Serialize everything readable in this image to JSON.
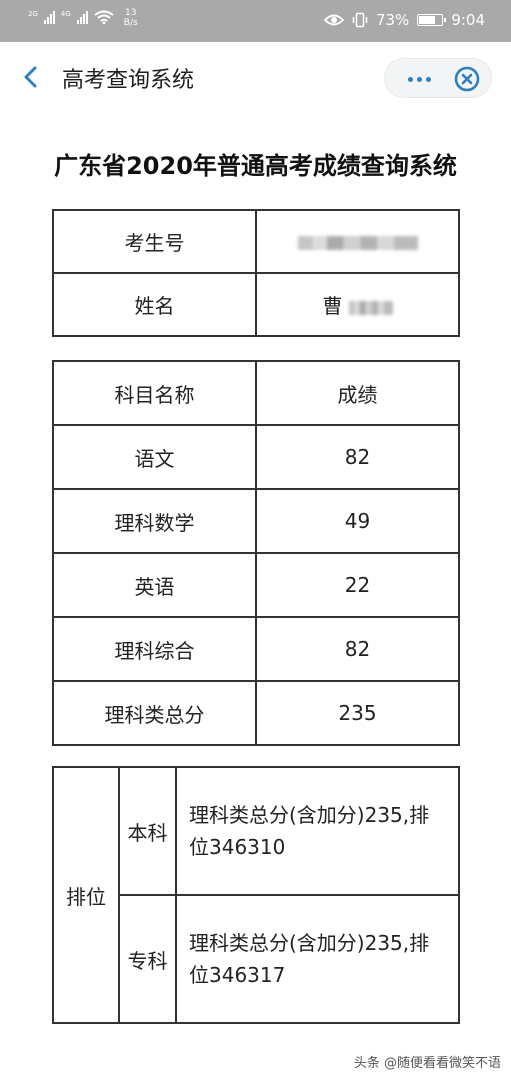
{
  "status_bar": {
    "network_1": "2G",
    "network_2": "4G",
    "speed_value": "13",
    "speed_unit": "B/s",
    "battery": "73%",
    "time": "9:04",
    "icons": [
      "signal-icon",
      "wifi-icon",
      "eye-icon",
      "vibrate-icon",
      "battery-icon"
    ]
  },
  "navbar": {
    "title": "高考查询系统",
    "back_icon": "chevron-left-icon",
    "more_icon": "more-dots-icon",
    "close_icon": "close-circle-icon",
    "accent": "#2d7fc1"
  },
  "page": {
    "title": "广东省2020年普通高考成绩查询系统"
  },
  "info": {
    "id_label": "考生号",
    "id_value": "",
    "name_label": "姓名",
    "name_value": "曹"
  },
  "scores": {
    "headers": [
      "科目名称",
      "成绩"
    ],
    "rows": [
      {
        "subject": "语文",
        "score": "82"
      },
      {
        "subject": "理科数学",
        "score": "49"
      },
      {
        "subject": "英语",
        "score": "22"
      },
      {
        "subject": "理科综合",
        "score": "82"
      },
      {
        "subject": "理科类总分",
        "score": "235"
      }
    ]
  },
  "ranking": {
    "label": "排位",
    "rows": [
      {
        "type": "本科",
        "value": "理科类总分(含加分)235,排位346310"
      },
      {
        "type": "专科",
        "value": "理科类总分(含加分)235,排位346317"
      }
    ]
  },
  "watermark": "头条 @随便看看微笑不语"
}
